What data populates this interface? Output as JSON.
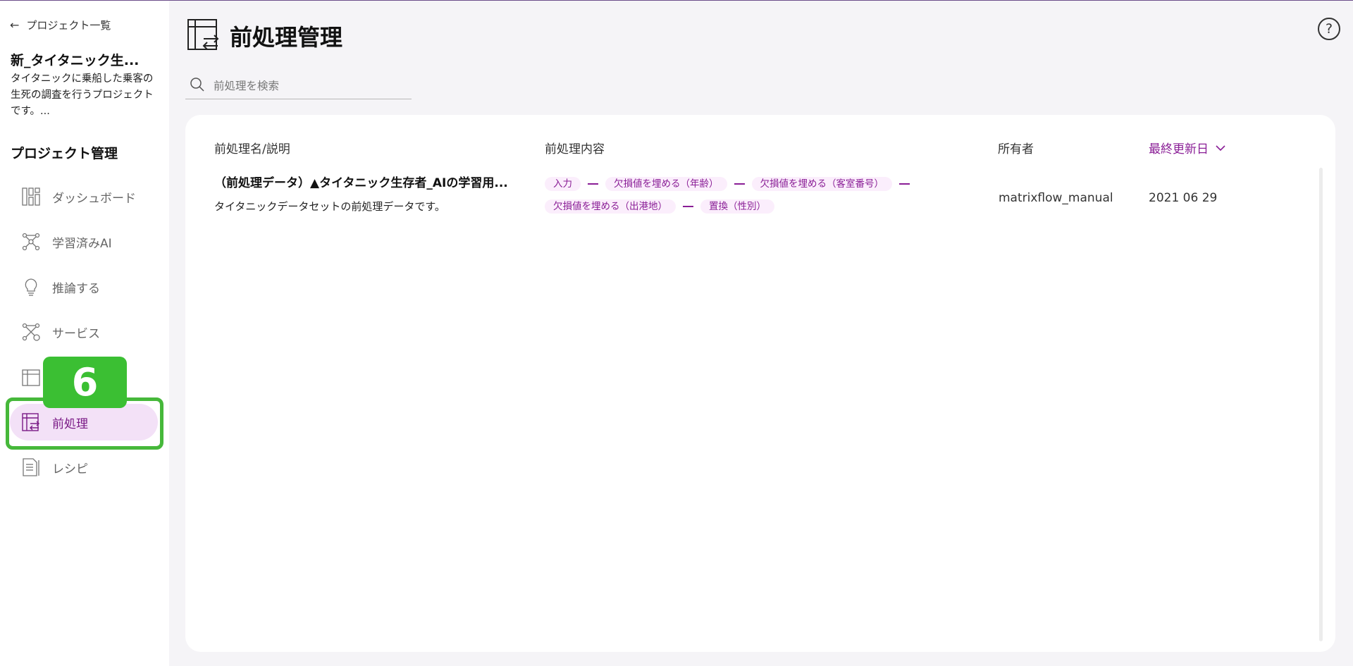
{
  "sidebar": {
    "back_label": "プロジェクト一覧",
    "project_name": "新_タイタニック生...",
    "project_desc": "タイタニックに乗船した乗客の生死の調査を行うプロジェクトです。...",
    "section_title": "プロジェクト管理",
    "items": [
      {
        "label": "ダッシュボード",
        "icon": "dashboard-icon"
      },
      {
        "label": "学習済みAI",
        "icon": "trained-ai-icon"
      },
      {
        "label": "推論する",
        "icon": "lightbulb-icon"
      },
      {
        "label": "サービス",
        "icon": "service-icon"
      },
      {
        "label": "",
        "icon": "dataset-icon"
      },
      {
        "label": "前処理",
        "icon": "preprocess-icon",
        "active": true
      },
      {
        "label": "レシピ",
        "icon": "recipe-icon"
      }
    ]
  },
  "annotation": {
    "step_number": "6",
    "highlight_color": "#46b83a"
  },
  "header": {
    "title": "前処理管理",
    "help": "?"
  },
  "search": {
    "placeholder": "前処理を検索"
  },
  "table": {
    "columns": {
      "name": "前処理名/説明",
      "content": "前処理内容",
      "owner": "所有者",
      "updated": "最終更新日"
    },
    "rows": [
      {
        "title": "（前処理データ）▲タイタニック生存者_AIの学習用...",
        "description": "タイタニックデータセットの前処理データです。",
        "steps": [
          "入力",
          "欠損値を埋める（年齢）",
          "欠損値を埋める（客室番号）",
          "欠損値を埋める（出港地）",
          "置換（性別）"
        ],
        "owner": "matrixflow_manual",
        "updated": "2021 06 29"
      }
    ]
  },
  "colors": {
    "accent": "#8a1e96",
    "active_bg": "#f3e1f7",
    "tag_bg": "#fbeefc",
    "annotation_green": "#3bbf33"
  }
}
